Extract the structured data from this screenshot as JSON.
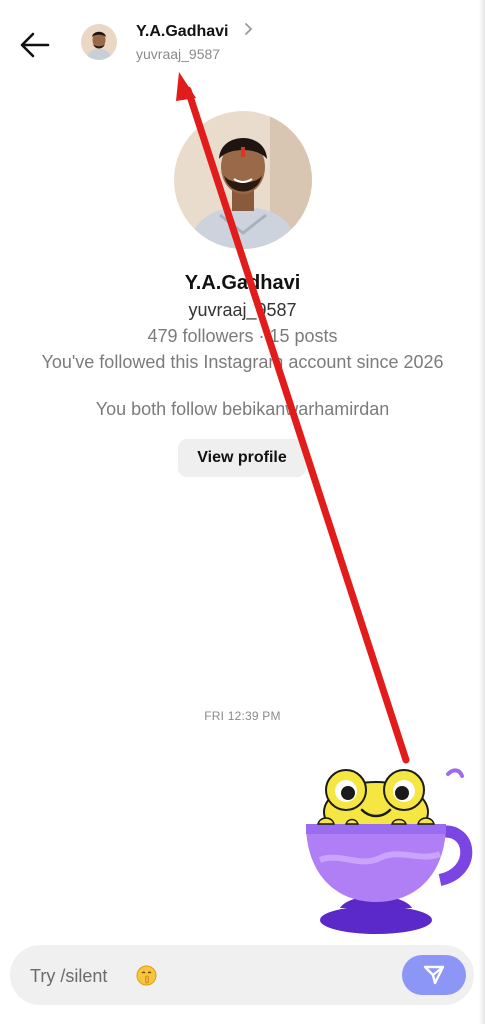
{
  "header": {
    "title": "Y.A.Gadhavi",
    "handle": "yuvraaj_9587",
    "chevron": ">",
    "back_icon": "arrow-left-icon"
  },
  "profile": {
    "name": "Y.A.Gadhavi",
    "handle": "yuvraaj_9587",
    "stats": "479 followers · 15 posts",
    "since": "You've followed this Instagram account since 2026",
    "mutual": "You both follow bebikanwarhamirdan",
    "view_profile_label": "View profile"
  },
  "messages": {
    "timestamp": "FRI 12:39 PM",
    "sticker": "frog-in-teacup-sticker"
  },
  "composer": {
    "placeholder": "Try /silent",
    "emoji": "shushing-face-emoji",
    "send_icon": "send-icon"
  },
  "colors": {
    "send_button": "#8b96f6",
    "annotation_arrow": "#e21b1b",
    "sticker_cup": "#b07ef5",
    "sticker_frog": "#f5e642"
  }
}
